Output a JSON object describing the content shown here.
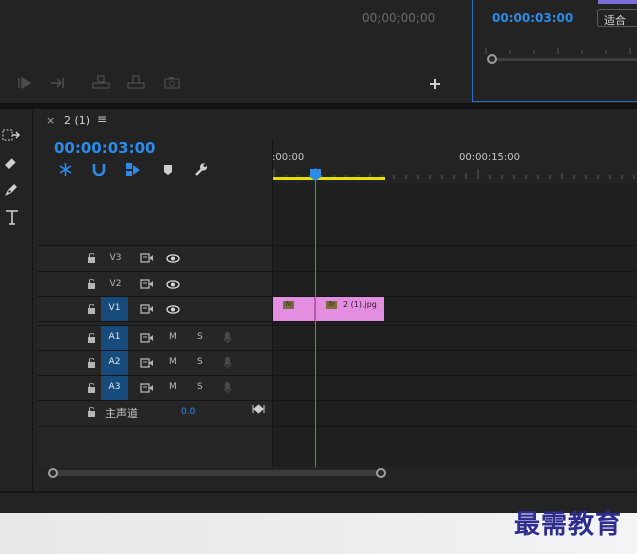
{
  "source_monitor": {
    "timecode": "00;00;00;00"
  },
  "program_monitor": {
    "timecode": "00:00:03:00",
    "fit_label": "适合"
  },
  "timeline": {
    "tab_label": "2 (1)",
    "tab_close": "×",
    "menu_icon": "≡",
    "timecode": "00:00:03:00",
    "ruler": [
      ":00:00",
      "00:00:15:00"
    ],
    "tracks": {
      "video": [
        {
          "label": "V3",
          "selected": false
        },
        {
          "label": "V2",
          "selected": false
        },
        {
          "label": "V1",
          "selected": true
        }
      ],
      "audio": [
        {
          "label": "A1",
          "mute": "M",
          "solo": "S"
        },
        {
          "label": "A2",
          "mute": "M",
          "solo": "S"
        },
        {
          "label": "A3",
          "mute": "M",
          "solo": "S"
        }
      ],
      "master": {
        "label": "主声道",
        "value": "0.0"
      }
    },
    "clips": [
      {
        "fx": "fx",
        "name": ""
      },
      {
        "fx": "fx",
        "name": "2 (1).jpg"
      }
    ],
    "clip_color": "#e38ee0"
  },
  "watermark": "最需教育",
  "colors": {
    "accent": "#2d8ceb",
    "background": "#232323",
    "panel": "#1e1e1e",
    "work_area": "#e8e100",
    "playhead": "#2d8ceb"
  }
}
